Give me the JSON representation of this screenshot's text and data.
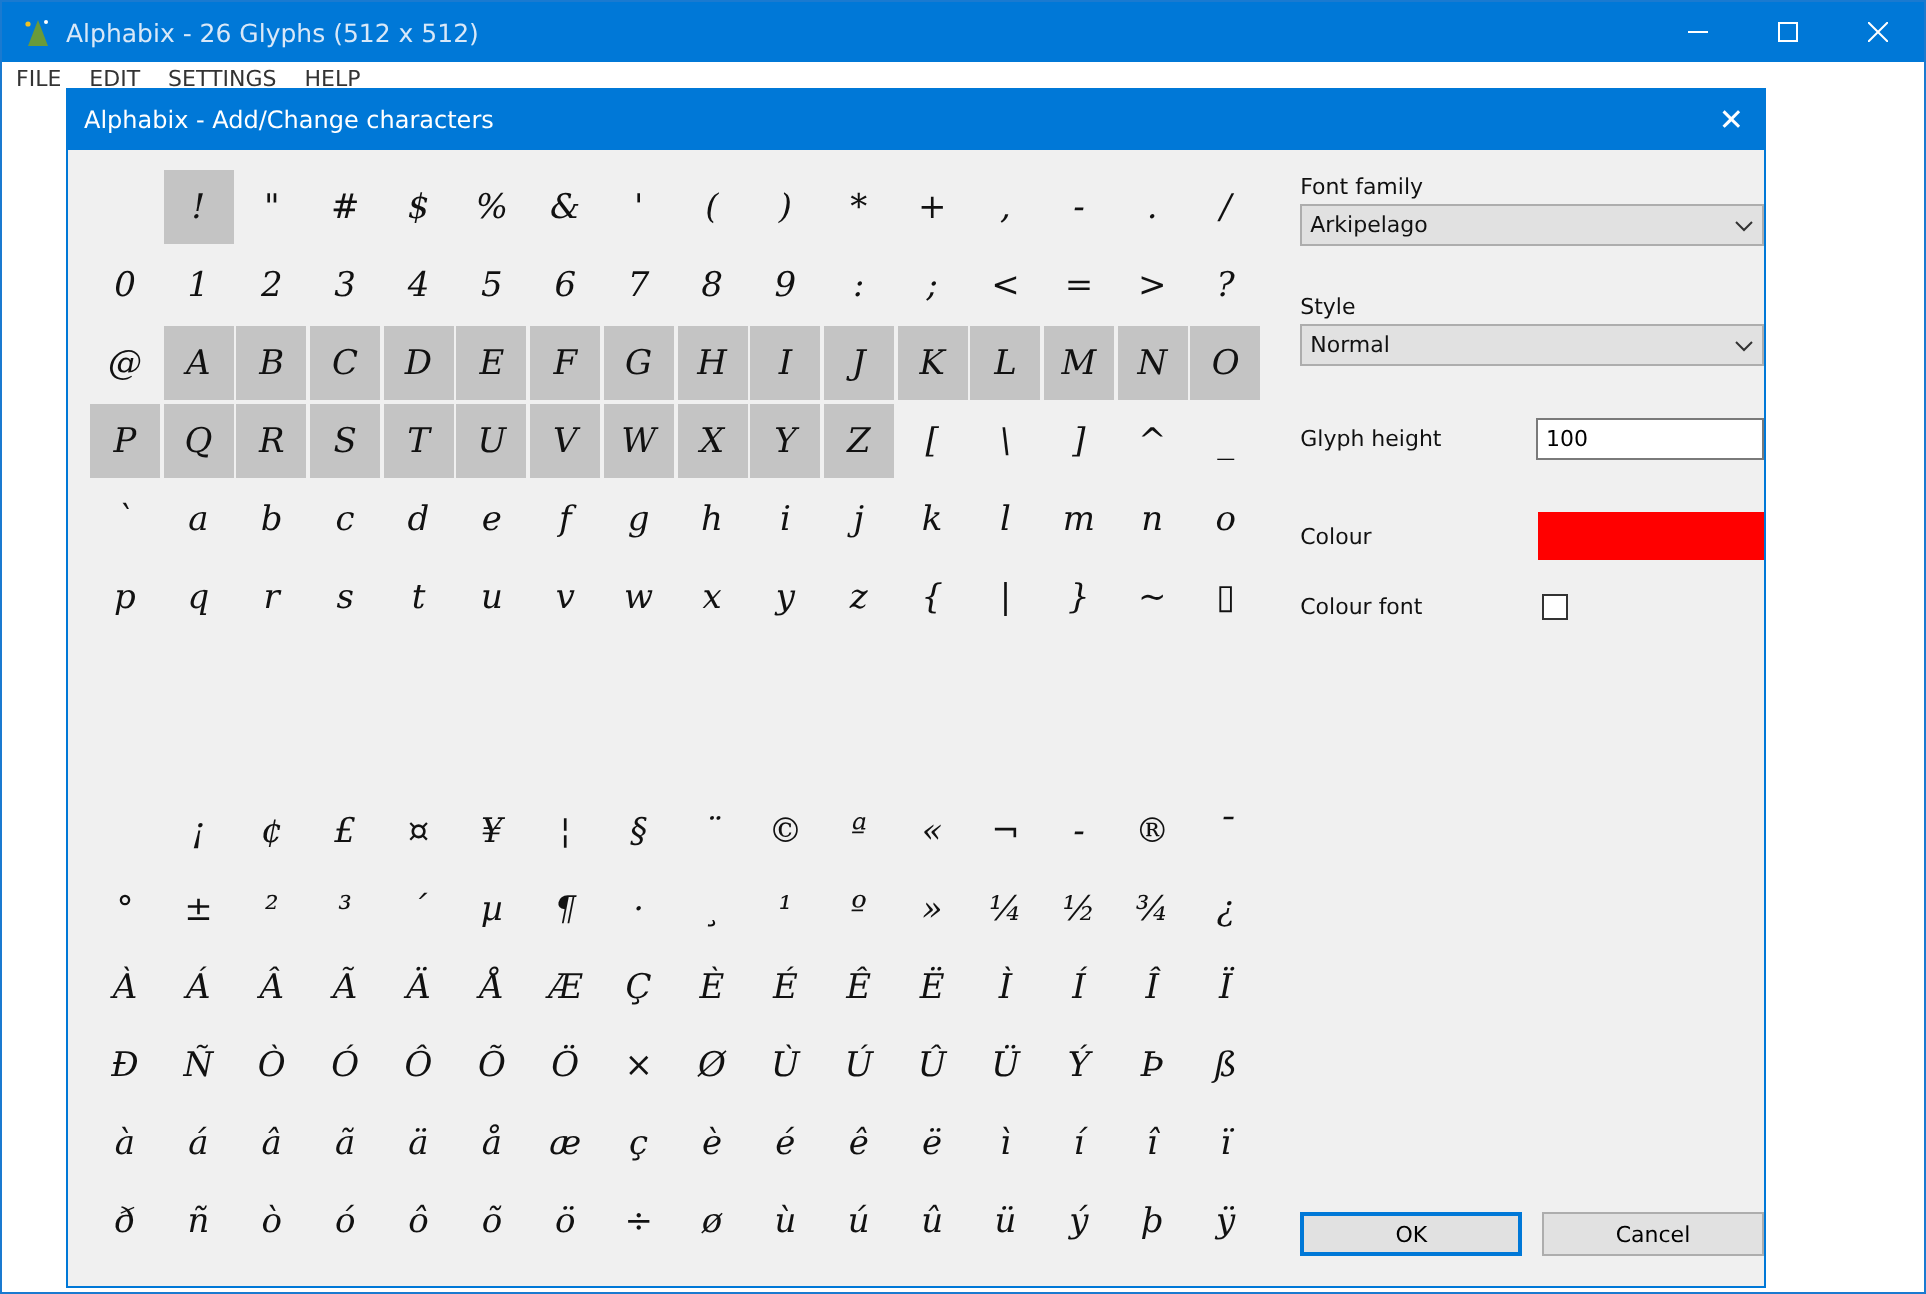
{
  "window": {
    "title": "Alphabix - 26 Glyphs (512 x 512)"
  },
  "menu": [
    "FILE",
    "EDIT",
    "SETTINGS",
    "HELP"
  ],
  "dialog": {
    "title": "Alphabix - Add/Change characters",
    "close": "✕"
  },
  "glyph_grid": {
    "rows": [
      {
        "kind": "chars",
        "cells": [
          {
            "included": false
          },
          {
            "char": "!",
            "included": true
          },
          {
            "char": "\"",
            "included": false
          },
          {
            "char": "#",
            "included": false
          },
          {
            "char": "$",
            "included": false
          },
          {
            "char": "%",
            "included": false
          },
          {
            "char": "&",
            "included": false
          },
          {
            "char": "'",
            "included": false
          },
          {
            "char": "(",
            "included": false
          },
          {
            "char": ")",
            "included": false
          },
          {
            "char": "*",
            "included": false
          },
          {
            "char": "+",
            "included": false
          },
          {
            "char": ",",
            "included": false
          },
          {
            "char": "-",
            "included": false
          },
          {
            "char": ".",
            "included": false
          },
          {
            "char": "/",
            "included": false
          }
        ]
      },
      {
        "kind": "chars",
        "cells": [
          {
            "char": "0",
            "included": false
          },
          {
            "char": "1",
            "included": false
          },
          {
            "char": "2",
            "included": false
          },
          {
            "char": "3",
            "included": false
          },
          {
            "char": "4",
            "included": false
          },
          {
            "char": "5",
            "included": false
          },
          {
            "char": "6",
            "included": false
          },
          {
            "char": "7",
            "included": false
          },
          {
            "char": "8",
            "included": false
          },
          {
            "char": "9",
            "included": false
          },
          {
            "char": ":",
            "included": false
          },
          {
            "char": ";",
            "included": false
          },
          {
            "char": "<",
            "included": false
          },
          {
            "char": "=",
            "included": false
          },
          {
            "char": ">",
            "included": false
          },
          {
            "char": "?",
            "included": false
          }
        ]
      },
      {
        "kind": "chars",
        "cells": [
          {
            "char": "@",
            "included": false
          },
          {
            "char": "A",
            "included": true
          },
          {
            "char": "B",
            "included": true
          },
          {
            "char": "C",
            "included": true
          },
          {
            "char": "D",
            "included": true
          },
          {
            "char": "E",
            "included": true
          },
          {
            "char": "F",
            "included": true
          },
          {
            "char": "G",
            "included": true
          },
          {
            "char": "H",
            "included": true
          },
          {
            "char": "I",
            "included": true
          },
          {
            "char": "J",
            "included": true
          },
          {
            "char": "K",
            "included": true
          },
          {
            "char": "L",
            "included": true
          },
          {
            "char": "M",
            "included": true
          },
          {
            "char": "N",
            "included": true
          },
          {
            "char": "O",
            "included": true
          }
        ]
      },
      {
        "kind": "chars",
        "cells": [
          {
            "char": "P",
            "included": true
          },
          {
            "char": "Q",
            "included": true
          },
          {
            "char": "R",
            "included": true
          },
          {
            "char": "S",
            "included": true
          },
          {
            "char": "T",
            "included": true
          },
          {
            "char": "U",
            "included": true
          },
          {
            "char": "V",
            "included": true
          },
          {
            "char": "W",
            "included": true
          },
          {
            "char": "X",
            "included": true
          },
          {
            "char": "Y",
            "included": true
          },
          {
            "char": "Z",
            "included": true
          },
          {
            "char": "[",
            "included": false
          },
          {
            "char": "\\",
            "included": false
          },
          {
            "char": "]",
            "included": false
          },
          {
            "char": "^",
            "included": false
          },
          {
            "char": "_",
            "included": false
          }
        ]
      },
      {
        "kind": "chars",
        "cells": [
          {
            "char": "`",
            "included": false
          },
          {
            "char": "a",
            "included": false
          },
          {
            "char": "b",
            "included": false
          },
          {
            "char": "c",
            "included": false
          },
          {
            "char": "d",
            "included": false
          },
          {
            "char": "e",
            "included": false
          },
          {
            "char": "f",
            "included": false
          },
          {
            "char": "g",
            "included": false
          },
          {
            "char": "h",
            "included": false
          },
          {
            "char": "i",
            "included": false
          },
          {
            "char": "j",
            "included": false
          },
          {
            "char": "k",
            "included": false
          },
          {
            "char": "l",
            "included": false
          },
          {
            "char": "m",
            "included": false
          },
          {
            "char": "n",
            "included": false
          },
          {
            "char": "o",
            "included": false
          }
        ]
      },
      {
        "kind": "chars",
        "cells": [
          {
            "char": "p",
            "included": false
          },
          {
            "char": "q",
            "included": false
          },
          {
            "char": "r",
            "included": false
          },
          {
            "char": "s",
            "included": false
          },
          {
            "char": "t",
            "included": false
          },
          {
            "char": "u",
            "included": false
          },
          {
            "char": "v",
            "included": false
          },
          {
            "char": "w",
            "included": false
          },
          {
            "char": "x",
            "included": false
          },
          {
            "char": "y",
            "included": false
          },
          {
            "char": "z",
            "included": false
          },
          {
            "char": "{",
            "included": false
          },
          {
            "char": "|",
            "included": false
          },
          {
            "char": "}",
            "included": false
          },
          {
            "char": "~",
            "included": false
          },
          {
            "char": "▯",
            "included": false
          }
        ]
      },
      {
        "kind": "empty"
      },
      {
        "kind": "empty"
      },
      {
        "kind": "chars",
        "cells": [
          {
            "included": false
          },
          {
            "char": "¡",
            "included": false
          },
          {
            "char": "¢",
            "included": false
          },
          {
            "char": "£",
            "included": false
          },
          {
            "char": "¤",
            "included": false
          },
          {
            "char": "¥",
            "included": false
          },
          {
            "char": "¦",
            "included": false
          },
          {
            "char": "§",
            "included": false
          },
          {
            "char": "¨",
            "included": false
          },
          {
            "char": "©",
            "included": false
          },
          {
            "char": "ª",
            "included": false
          },
          {
            "char": "«",
            "included": false
          },
          {
            "char": "¬",
            "included": false
          },
          {
            "char": "-",
            "included": false
          },
          {
            "char": "®",
            "included": false
          },
          {
            "char": "¯",
            "included": false
          }
        ]
      },
      {
        "kind": "chars",
        "cells": [
          {
            "char": "°",
            "included": false
          },
          {
            "char": "±",
            "included": false
          },
          {
            "char": "²",
            "included": false
          },
          {
            "char": "³",
            "included": false
          },
          {
            "char": "´",
            "included": false
          },
          {
            "char": "µ",
            "included": false
          },
          {
            "char": "¶",
            "included": false
          },
          {
            "char": "·",
            "included": false
          },
          {
            "char": "¸",
            "included": false
          },
          {
            "char": "¹",
            "included": false
          },
          {
            "char": "º",
            "included": false
          },
          {
            "char": "»",
            "included": false
          },
          {
            "char": "¼",
            "included": false
          },
          {
            "char": "½",
            "included": false
          },
          {
            "char": "¾",
            "included": false
          },
          {
            "char": "¿",
            "included": false
          }
        ]
      },
      {
        "kind": "chars",
        "cells": [
          {
            "char": "À",
            "included": false
          },
          {
            "char": "Á",
            "included": false
          },
          {
            "char": "Â",
            "included": false
          },
          {
            "char": "Ã",
            "included": false
          },
          {
            "char": "Ä",
            "included": false
          },
          {
            "char": "Å",
            "included": false
          },
          {
            "char": "Æ",
            "included": false
          },
          {
            "char": "Ç",
            "included": false
          },
          {
            "char": "È",
            "included": false
          },
          {
            "char": "É",
            "included": false
          },
          {
            "char": "Ê",
            "included": false
          },
          {
            "char": "Ë",
            "included": false
          },
          {
            "char": "Ì",
            "included": false
          },
          {
            "char": "Í",
            "included": false
          },
          {
            "char": "Î",
            "included": false
          },
          {
            "char": "Ï",
            "included": false
          }
        ]
      },
      {
        "kind": "chars",
        "cells": [
          {
            "char": "Ð",
            "included": false
          },
          {
            "char": "Ñ",
            "included": false
          },
          {
            "char": "Ò",
            "included": false
          },
          {
            "char": "Ó",
            "included": false
          },
          {
            "char": "Ô",
            "included": false
          },
          {
            "char": "Õ",
            "included": false
          },
          {
            "char": "Ö",
            "included": false
          },
          {
            "char": "×",
            "included": false
          },
          {
            "char": "Ø",
            "included": false
          },
          {
            "char": "Ù",
            "included": false
          },
          {
            "char": "Ú",
            "included": false
          },
          {
            "char": "Û",
            "included": false
          },
          {
            "char": "Ü",
            "included": false
          },
          {
            "char": "Ý",
            "included": false
          },
          {
            "char": "Þ",
            "included": false
          },
          {
            "char": "ß",
            "included": false
          }
        ]
      },
      {
        "kind": "chars",
        "cells": [
          {
            "char": "à",
            "included": false
          },
          {
            "char": "á",
            "included": false
          },
          {
            "char": "â",
            "included": false
          },
          {
            "char": "ã",
            "included": false
          },
          {
            "char": "ä",
            "included": false
          },
          {
            "char": "å",
            "included": false
          },
          {
            "char": "æ",
            "included": false
          },
          {
            "char": "ç",
            "included": false
          },
          {
            "char": "è",
            "included": false
          },
          {
            "char": "é",
            "included": false
          },
          {
            "char": "ê",
            "included": false
          },
          {
            "char": "ë",
            "included": false
          },
          {
            "char": "ì",
            "included": false
          },
          {
            "char": "í",
            "included": false
          },
          {
            "char": "î",
            "included": false
          },
          {
            "char": "ï",
            "included": false
          }
        ]
      },
      {
        "kind": "chars",
        "cells": [
          {
            "char": "ð",
            "included": false
          },
          {
            "char": "ñ",
            "included": false
          },
          {
            "char": "ò",
            "included": false
          },
          {
            "char": "ó",
            "included": false
          },
          {
            "char": "ô",
            "included": false
          },
          {
            "char": "õ",
            "included": false
          },
          {
            "char": "ö",
            "included": false
          },
          {
            "char": "÷",
            "included": false
          },
          {
            "char": "ø",
            "included": false
          },
          {
            "char": "ù",
            "included": false
          },
          {
            "char": "ú",
            "included": false
          },
          {
            "char": "û",
            "included": false
          },
          {
            "char": "ü",
            "included": false
          },
          {
            "char": "ý",
            "included": false
          },
          {
            "char": "þ",
            "included": false
          },
          {
            "char": "ÿ",
            "included": false
          }
        ]
      }
    ]
  },
  "settings": {
    "font_family": {
      "label": "Font family",
      "value": "Arkipelago"
    },
    "style": {
      "label": "Style",
      "value": "Normal"
    },
    "glyph_height": {
      "label": "Glyph height",
      "value": "100"
    },
    "colour": {
      "label": "Colour",
      "color": "#ff0000"
    },
    "colour_font": {
      "label": "Colour font",
      "checked": false
    }
  },
  "buttons": [
    {
      "label": "OK",
      "default": true
    },
    {
      "label": "Cancel",
      "default": false
    }
  ]
}
